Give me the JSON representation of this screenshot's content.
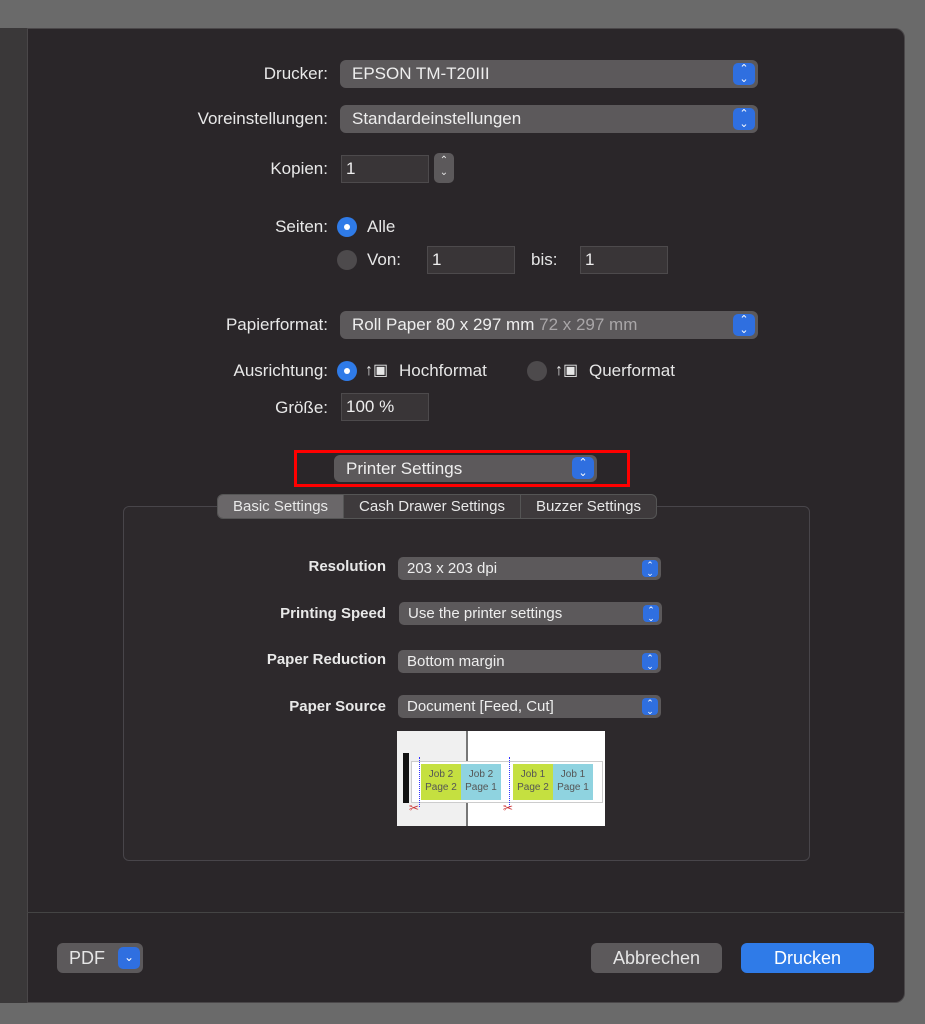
{
  "printer": {
    "label": "Drucker:",
    "value": "EPSON TM-T20III"
  },
  "presets": {
    "label": "Voreinstellungen:",
    "value": "Standardeinstellungen"
  },
  "copies": {
    "label": "Kopien:",
    "value": "1"
  },
  "pages": {
    "label": "Seiten:",
    "all": "Alle",
    "from_label": "Von:",
    "from": "1",
    "to_label": "bis:",
    "to": "1",
    "selected": "all"
  },
  "paper": {
    "label": "Papierformat:",
    "value": "Roll Paper 80 x 297 mm",
    "dimension": "72 x 297 mm"
  },
  "orientation": {
    "label": "Ausrichtung:",
    "portrait": "Hochformat",
    "landscape": "Querformat",
    "selected": "portrait"
  },
  "scale": {
    "label": "Größe:",
    "value": "100 %"
  },
  "section": {
    "value": "Printer Settings",
    "highlight_color": "#ff0000"
  },
  "tabs": [
    "Basic Settings",
    "Cash Drawer Settings",
    "Buzzer Settings"
  ],
  "settings": [
    {
      "label": "Resolution",
      "value": "203 x 203 dpi"
    },
    {
      "label": "Printing Speed",
      "value": "Use the printer settings"
    },
    {
      "label": "Paper Reduction",
      "value": "Bottom margin"
    },
    {
      "label": "Paper Source",
      "value": "Document [Feed, Cut]"
    }
  ],
  "preview": {
    "jobs": [
      {
        "line1": "Job 2",
        "line2": "Page 2",
        "color": "#c5e040"
      },
      {
        "line1": "Job 2",
        "line2": "Page 1",
        "color": "#8fd3e0"
      },
      {
        "line1": "Job 1",
        "line2": "Page 2",
        "color": "#c5e040"
      },
      {
        "line1": "Job 1",
        "line2": "Page 1",
        "color": "#8fd3e0"
      }
    ]
  },
  "footer": {
    "pdf": "PDF",
    "cancel": "Abbrechen",
    "print": "Drucken"
  },
  "accent": "#2f7be8"
}
